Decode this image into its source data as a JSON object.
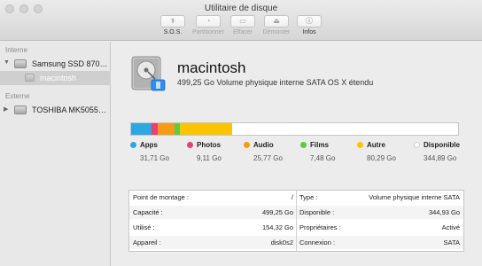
{
  "window": {
    "title": "Utilitaire de disque"
  },
  "toolbar": {
    "buttons": [
      {
        "label": "S.O.S.",
        "icon": "stethoscope-icon",
        "glyph": "⚕",
        "enabled": true
      },
      {
        "label": "Partitionner",
        "icon": "partition-icon",
        "glyph": "◔",
        "enabled": false
      },
      {
        "label": "Effacer",
        "icon": "erase-icon",
        "glyph": "▭",
        "enabled": false
      },
      {
        "label": "Démonter",
        "icon": "unmount-icon",
        "glyph": "⏏",
        "enabled": false
      },
      {
        "label": "Infos",
        "icon": "info-icon",
        "glyph": "ⓘ",
        "enabled": true
      }
    ]
  },
  "sidebar": {
    "internal_label": "Interne",
    "external_label": "Externe",
    "internal_disk": "Samsung SSD 870…",
    "internal_volume": "macintosh",
    "external_disk": "TOSHIBA MK5055…"
  },
  "volume": {
    "name": "macintosh",
    "description": "499,25 Go Volume physique interne SATA OS X étendu"
  },
  "usage": [
    {
      "name": "Apps",
      "size": "31,71 Go",
      "color": "#29a9e0",
      "fraction": 0.0635
    },
    {
      "name": "Photos",
      "size": "9,11 Go",
      "color": "#ea3f73",
      "fraction": 0.0183
    },
    {
      "name": "Audio",
      "size": "25,77 Go",
      "color": "#f59b16",
      "fraction": 0.0516
    },
    {
      "name": "Films",
      "size": "7,48 Go",
      "color": "#62c840",
      "fraction": 0.015
    },
    {
      "name": "Autre",
      "size": "80,29 Go",
      "color": "#fdc500",
      "fraction": 0.1608
    },
    {
      "name": "Disponible",
      "size": "344,89 Go",
      "color": "#ffffff",
      "fraction": 0.6908
    }
  ],
  "info": {
    "rows": [
      {
        "l_label": "Point de montage :",
        "l_value": "/",
        "r_label": "Type :",
        "r_value": "Volume physique interne SATA"
      },
      {
        "l_label": "Capacité :",
        "l_value": "499,25 Go",
        "r_label": "Disponible :",
        "r_value": "344,93 Go"
      },
      {
        "l_label": "Utilisé :",
        "l_value": "154,32 Go",
        "r_label": "Propriétaires :",
        "r_value": "Activé"
      },
      {
        "l_label": "Appareil :",
        "l_value": "disk0s2",
        "r_label": "Connexion :",
        "r_value": "SATA"
      }
    ]
  }
}
